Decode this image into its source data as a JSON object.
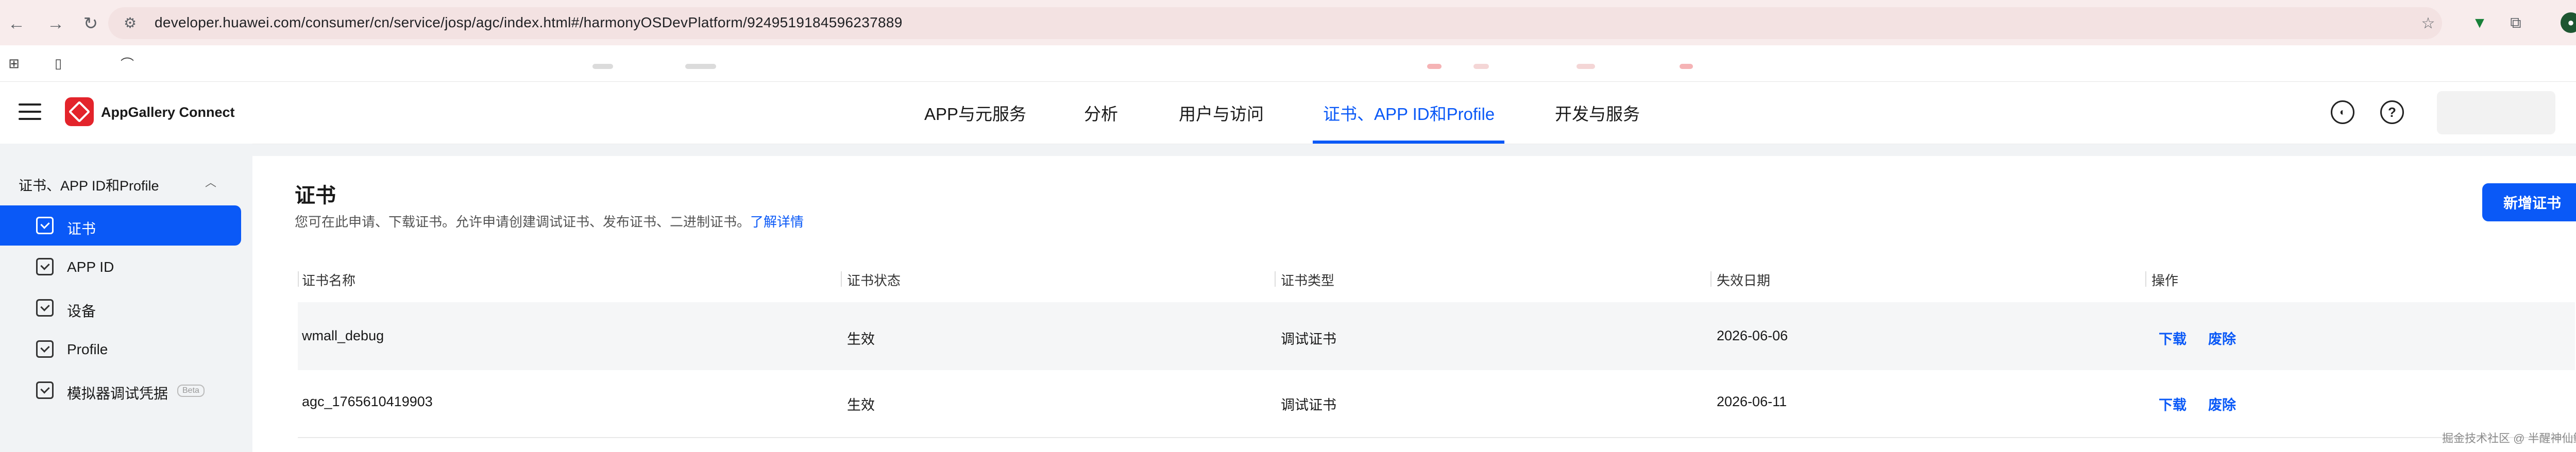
{
  "browser": {
    "url": "developer.huawei.com/consumer/cn/service/josp/agc/index.html#/harmonyOSDevPlatform/9249519184596237889",
    "back_icon": "arrow-left-icon",
    "forward_icon": "arrow-right-icon",
    "reload_icon": "reload-icon"
  },
  "app": {
    "brand": "AppGallery Connect",
    "brand_color": "#e3242b",
    "accent_color": "#0a59f7"
  },
  "topnav": {
    "tabs": [
      {
        "label": "APP与元服务"
      },
      {
        "label": "分析"
      },
      {
        "label": "用户与访问"
      },
      {
        "label": "证书、APP ID和Profile"
      },
      {
        "label": "开发与服务"
      }
    ],
    "help_icon_glyph": "?"
  },
  "sidebar": {
    "section": "证书、APP ID和Profile",
    "items": [
      {
        "label": "证书"
      },
      {
        "label": "APP ID"
      },
      {
        "label": "设备"
      },
      {
        "label": "Profile"
      },
      {
        "label": "模拟器调试凭据",
        "badge": "Beta"
      }
    ]
  },
  "page": {
    "title": "证书",
    "description": "您可在此申请、下载证书。允许申请创建调试证书、发布证书、二进制证书。",
    "learn_more": "了解详情",
    "new_button": "新增证书"
  },
  "table": {
    "columns": [
      "证书名称",
      "证书状态",
      "证书类型",
      "失效日期",
      "操作"
    ],
    "rows": [
      {
        "name": "wmall_debug",
        "status": "生效",
        "type": "调试证书",
        "expiry": "2026-06-06",
        "download": "下载",
        "revoke": "废除"
      },
      {
        "name": "agc_1765610419903",
        "status": "生效",
        "type": "调试证书",
        "expiry": "2026-06-11",
        "download": "下载",
        "revoke": "废除"
      }
    ]
  },
  "watermark": "掘金技术社区 @ 半醒神仙鲥"
}
